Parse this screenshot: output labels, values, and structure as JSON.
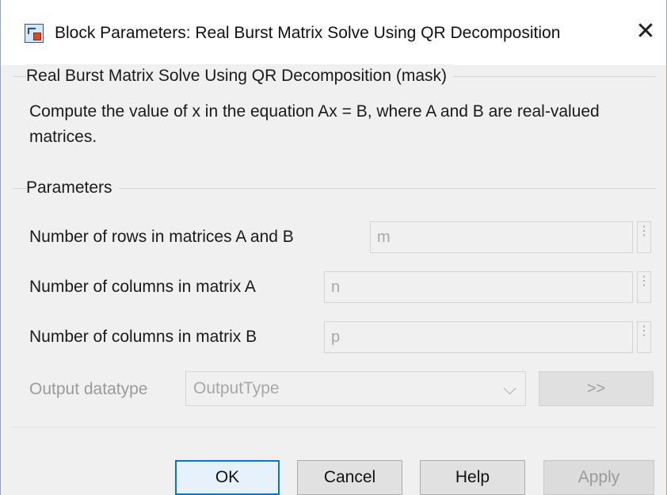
{
  "window": {
    "title": "Block Parameters: Real Burst Matrix Solve Using QR Decomposition",
    "close_glyph": "✕",
    "icon": "simulink-block-icon"
  },
  "mask": {
    "group_title": "Real Burst Matrix Solve Using QR Decomposition (mask)",
    "description": "Compute the value of x in the equation Ax = B, where A and B are real-valued matrices."
  },
  "parameters": {
    "group_title": "Parameters",
    "rows": {
      "label": "Number of rows in matrices A and B",
      "value": "m",
      "menu_glyph": "⋮"
    },
    "cols_a": {
      "label": "Number of columns in matrix A",
      "value": "n",
      "menu_glyph": "⋮"
    },
    "cols_b": {
      "label": "Number of columns in matrix B",
      "value": "p",
      "menu_glyph": "⋮"
    },
    "output_datatype": {
      "label": "Output datatype",
      "selected": "OutputType",
      "assistant_label": ">>"
    }
  },
  "buttons": {
    "ok": "OK",
    "cancel": "Cancel",
    "help": "Help",
    "apply": "Apply"
  },
  "colors": {
    "default_button_border": "#0078d7",
    "disabled_text": "#9a9a9a",
    "background": "#f0f0f0"
  }
}
